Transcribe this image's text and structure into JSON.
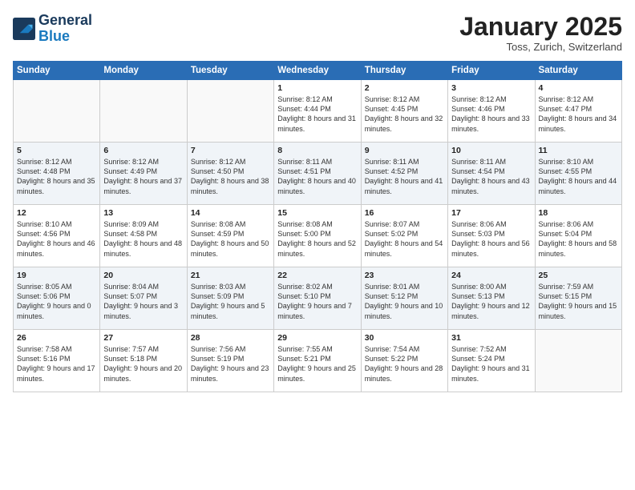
{
  "header": {
    "logo_line1": "General",
    "logo_line2": "Blue",
    "month": "January 2025",
    "location": "Toss, Zurich, Switzerland"
  },
  "weekdays": [
    "Sunday",
    "Monday",
    "Tuesday",
    "Wednesday",
    "Thursday",
    "Friday",
    "Saturday"
  ],
  "weeks": [
    [
      {
        "day": "",
        "sunrise": "",
        "sunset": "",
        "daylight": ""
      },
      {
        "day": "",
        "sunrise": "",
        "sunset": "",
        "daylight": ""
      },
      {
        "day": "",
        "sunrise": "",
        "sunset": "",
        "daylight": ""
      },
      {
        "day": "1",
        "sunrise": "Sunrise: 8:12 AM",
        "sunset": "Sunset: 4:44 PM",
        "daylight": "Daylight: 8 hours and 31 minutes."
      },
      {
        "day": "2",
        "sunrise": "Sunrise: 8:12 AM",
        "sunset": "Sunset: 4:45 PM",
        "daylight": "Daylight: 8 hours and 32 minutes."
      },
      {
        "day": "3",
        "sunrise": "Sunrise: 8:12 AM",
        "sunset": "Sunset: 4:46 PM",
        "daylight": "Daylight: 8 hours and 33 minutes."
      },
      {
        "day": "4",
        "sunrise": "Sunrise: 8:12 AM",
        "sunset": "Sunset: 4:47 PM",
        "daylight": "Daylight: 8 hours and 34 minutes."
      }
    ],
    [
      {
        "day": "5",
        "sunrise": "Sunrise: 8:12 AM",
        "sunset": "Sunset: 4:48 PM",
        "daylight": "Daylight: 8 hours and 35 minutes."
      },
      {
        "day": "6",
        "sunrise": "Sunrise: 8:12 AM",
        "sunset": "Sunset: 4:49 PM",
        "daylight": "Daylight: 8 hours and 37 minutes."
      },
      {
        "day": "7",
        "sunrise": "Sunrise: 8:12 AM",
        "sunset": "Sunset: 4:50 PM",
        "daylight": "Daylight: 8 hours and 38 minutes."
      },
      {
        "day": "8",
        "sunrise": "Sunrise: 8:11 AM",
        "sunset": "Sunset: 4:51 PM",
        "daylight": "Daylight: 8 hours and 40 minutes."
      },
      {
        "day": "9",
        "sunrise": "Sunrise: 8:11 AM",
        "sunset": "Sunset: 4:52 PM",
        "daylight": "Daylight: 8 hours and 41 minutes."
      },
      {
        "day": "10",
        "sunrise": "Sunrise: 8:11 AM",
        "sunset": "Sunset: 4:54 PM",
        "daylight": "Daylight: 8 hours and 43 minutes."
      },
      {
        "day": "11",
        "sunrise": "Sunrise: 8:10 AM",
        "sunset": "Sunset: 4:55 PM",
        "daylight": "Daylight: 8 hours and 44 minutes."
      }
    ],
    [
      {
        "day": "12",
        "sunrise": "Sunrise: 8:10 AM",
        "sunset": "Sunset: 4:56 PM",
        "daylight": "Daylight: 8 hours and 46 minutes."
      },
      {
        "day": "13",
        "sunrise": "Sunrise: 8:09 AM",
        "sunset": "Sunset: 4:58 PM",
        "daylight": "Daylight: 8 hours and 48 minutes."
      },
      {
        "day": "14",
        "sunrise": "Sunrise: 8:08 AM",
        "sunset": "Sunset: 4:59 PM",
        "daylight": "Daylight: 8 hours and 50 minutes."
      },
      {
        "day": "15",
        "sunrise": "Sunrise: 8:08 AM",
        "sunset": "Sunset: 5:00 PM",
        "daylight": "Daylight: 8 hours and 52 minutes."
      },
      {
        "day": "16",
        "sunrise": "Sunrise: 8:07 AM",
        "sunset": "Sunset: 5:02 PM",
        "daylight": "Daylight: 8 hours and 54 minutes."
      },
      {
        "day": "17",
        "sunrise": "Sunrise: 8:06 AM",
        "sunset": "Sunset: 5:03 PM",
        "daylight": "Daylight: 8 hours and 56 minutes."
      },
      {
        "day": "18",
        "sunrise": "Sunrise: 8:06 AM",
        "sunset": "Sunset: 5:04 PM",
        "daylight": "Daylight: 8 hours and 58 minutes."
      }
    ],
    [
      {
        "day": "19",
        "sunrise": "Sunrise: 8:05 AM",
        "sunset": "Sunset: 5:06 PM",
        "daylight": "Daylight: 9 hours and 0 minutes."
      },
      {
        "day": "20",
        "sunrise": "Sunrise: 8:04 AM",
        "sunset": "Sunset: 5:07 PM",
        "daylight": "Daylight: 9 hours and 3 minutes."
      },
      {
        "day": "21",
        "sunrise": "Sunrise: 8:03 AM",
        "sunset": "Sunset: 5:09 PM",
        "daylight": "Daylight: 9 hours and 5 minutes."
      },
      {
        "day": "22",
        "sunrise": "Sunrise: 8:02 AM",
        "sunset": "Sunset: 5:10 PM",
        "daylight": "Daylight: 9 hours and 7 minutes."
      },
      {
        "day": "23",
        "sunrise": "Sunrise: 8:01 AM",
        "sunset": "Sunset: 5:12 PM",
        "daylight": "Daylight: 9 hours and 10 minutes."
      },
      {
        "day": "24",
        "sunrise": "Sunrise: 8:00 AM",
        "sunset": "Sunset: 5:13 PM",
        "daylight": "Daylight: 9 hours and 12 minutes."
      },
      {
        "day": "25",
        "sunrise": "Sunrise: 7:59 AM",
        "sunset": "Sunset: 5:15 PM",
        "daylight": "Daylight: 9 hours and 15 minutes."
      }
    ],
    [
      {
        "day": "26",
        "sunrise": "Sunrise: 7:58 AM",
        "sunset": "Sunset: 5:16 PM",
        "daylight": "Daylight: 9 hours and 17 minutes."
      },
      {
        "day": "27",
        "sunrise": "Sunrise: 7:57 AM",
        "sunset": "Sunset: 5:18 PM",
        "daylight": "Daylight: 9 hours and 20 minutes."
      },
      {
        "day": "28",
        "sunrise": "Sunrise: 7:56 AM",
        "sunset": "Sunset: 5:19 PM",
        "daylight": "Daylight: 9 hours and 23 minutes."
      },
      {
        "day": "29",
        "sunrise": "Sunrise: 7:55 AM",
        "sunset": "Sunset: 5:21 PM",
        "daylight": "Daylight: 9 hours and 25 minutes."
      },
      {
        "day": "30",
        "sunrise": "Sunrise: 7:54 AM",
        "sunset": "Sunset: 5:22 PM",
        "daylight": "Daylight: 9 hours and 28 minutes."
      },
      {
        "day": "31",
        "sunrise": "Sunrise: 7:52 AM",
        "sunset": "Sunset: 5:24 PM",
        "daylight": "Daylight: 9 hours and 31 minutes."
      },
      {
        "day": "",
        "sunrise": "",
        "sunset": "",
        "daylight": ""
      }
    ]
  ]
}
